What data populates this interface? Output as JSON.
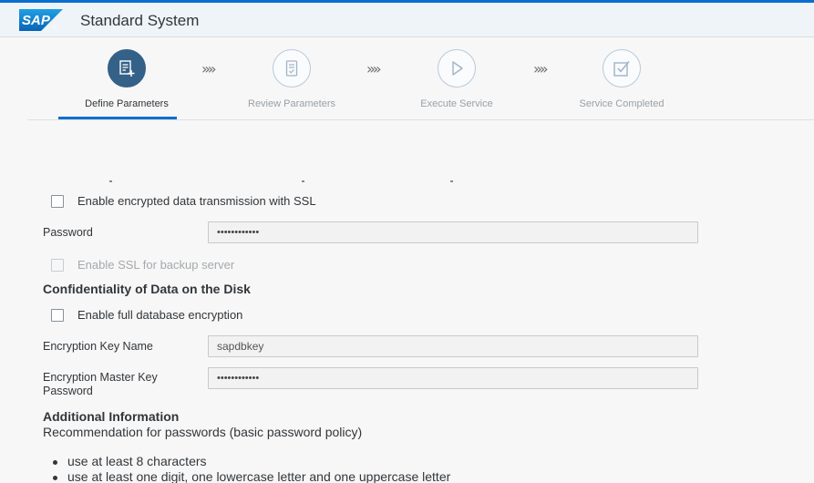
{
  "shell": {
    "logo_text": "SAP",
    "title": "Standard System"
  },
  "wizard": {
    "steps": [
      {
        "label": "Define Parameters",
        "icon": "form-edit-icon",
        "state": "active"
      },
      {
        "label": "Review Parameters",
        "icon": "document-review-icon",
        "state": "inactive"
      },
      {
        "label": "Execute Service",
        "icon": "play-icon",
        "state": "inactive"
      },
      {
        "label": "Service Completed",
        "icon": "checkbox-complete-icon",
        "state": "inactive"
      }
    ],
    "separator": "»»"
  },
  "form": {
    "ssl_checkbox_label": "Enable encrypted data transmission with SSL",
    "password_label": "Password",
    "password_value": "••••••••••••",
    "ssl_backup_label": "Enable SSL for backup server",
    "confidentiality_heading": "Confidentiality of Data on the Disk",
    "full_db_encryption_label": "Enable full database encryption",
    "encryption_key_name_label": "Encryption Key Name",
    "encryption_key_name_value": "sapdbkey",
    "master_key_password_label": "Encryption Master Key Password",
    "master_key_password_value": "••••••••••••"
  },
  "info": {
    "heading": "Additional Information",
    "text": "Recommendation for passwords (basic password policy)",
    "bullets": [
      "use at least 8 characters",
      "use at least one digit, one lowercase letter and one uppercase letter"
    ]
  },
  "colors": {
    "accent": "#0a6ed1",
    "active_step": "#346187",
    "shell_bg": "#eff4f9"
  }
}
